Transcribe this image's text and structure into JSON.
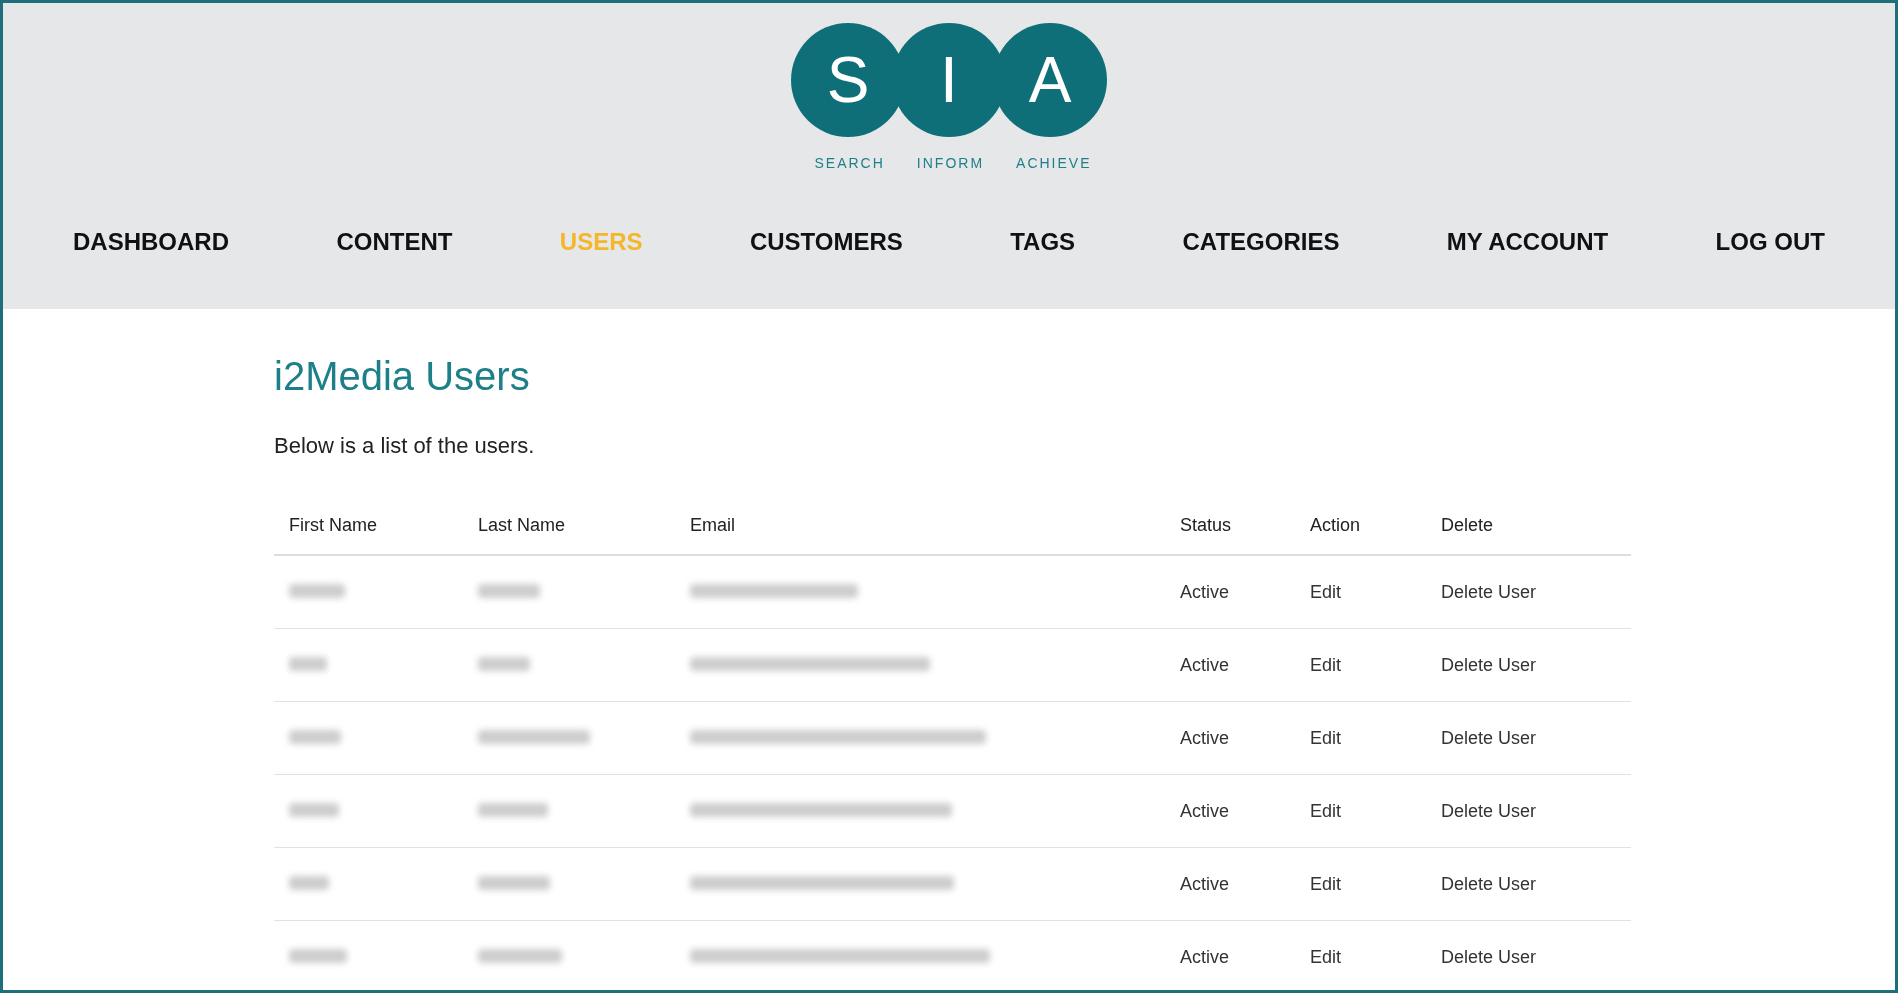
{
  "logo": {
    "letters": [
      "S",
      "I",
      "A"
    ],
    "words": [
      "SEARCH",
      "INFORM",
      "ACHIEVE"
    ]
  },
  "nav": [
    {
      "label": "DASHBOARD",
      "selected": false
    },
    {
      "label": "CONTENT",
      "selected": false
    },
    {
      "label": "USERS",
      "selected": true
    },
    {
      "label": "CUSTOMERS",
      "selected": false
    },
    {
      "label": "TAGS",
      "selected": false
    },
    {
      "label": "CATEGORIES",
      "selected": false
    },
    {
      "label": "MY ACCOUNT",
      "selected": false
    },
    {
      "label": "LOG OUT",
      "selected": false
    }
  ],
  "page": {
    "title": "i2Media Users",
    "intro": "Below is a list of the users."
  },
  "table": {
    "columns": [
      "First Name",
      "Last Name",
      "Email",
      "Status",
      "Action",
      "Delete"
    ],
    "rows": [
      {
        "status": "Active",
        "action": "Edit",
        "delete": "Delete User"
      },
      {
        "status": "Active",
        "action": "Edit",
        "delete": "Delete User"
      },
      {
        "status": "Active",
        "action": "Edit",
        "delete": "Delete User"
      },
      {
        "status": "Active",
        "action": "Edit",
        "delete": "Delete User"
      },
      {
        "status": "Active",
        "action": "Edit",
        "delete": "Delete User"
      },
      {
        "status": "Active",
        "action": "Edit",
        "delete": "Delete User"
      }
    ]
  }
}
